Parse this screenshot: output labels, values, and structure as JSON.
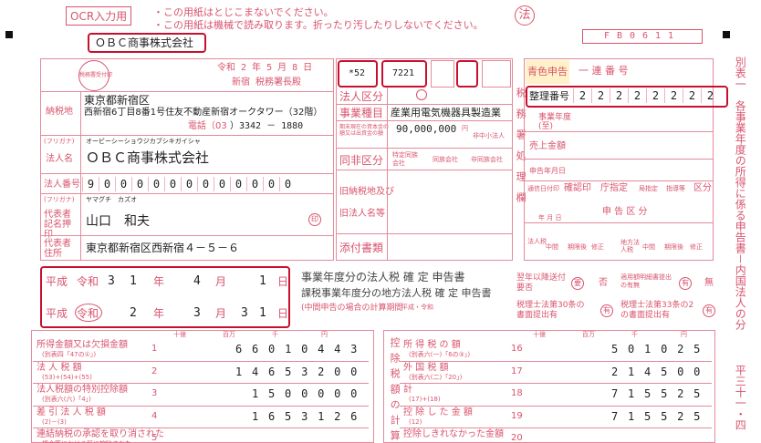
{
  "header": {
    "ocr_label": "OCR入力用",
    "notice1": "・この用紙はとじこまないでください。",
    "notice2": "・この用紙は機械で読み取ります。折ったり汚したりしないでください。",
    "hou_mark": "法",
    "form_code": "FB0611",
    "company_top": "ＯＢＣ商事株式会社"
  },
  "left": {
    "receipt_stamp": "税務署受付印",
    "date": "令和 2 年 5 月 8 日",
    "office": "新宿 税務署長殿",
    "address_label": "納税地",
    "address1": "東京都新宿区",
    "address2": "西新宿6丁目8番1号住友不動産新宿オークタワー（32階）",
    "phone_label": "電話（03",
    "phone_value": "）3342 － 1880",
    "furigana_label": "(フリガナ)",
    "furigana_company": "オービーシーショウジカブシキガイシャ",
    "corp_name_label": "法人名",
    "corp_name": "ＯＢＣ商事株式会社",
    "corp_number_label": "法人番号",
    "corp_number": [
      "9",
      "0",
      "0",
      "0",
      "0",
      "0",
      "0",
      "0",
      "0",
      "0",
      "0",
      "0",
      "0"
    ],
    "furigana_rep_label": "(フリガナ)",
    "furigana_rep": "ヤマグチ　カズオ",
    "rep_label": "代表者記名押印",
    "rep_name": "山口　和夫",
    "seal": "印",
    "rep_addr_label": "代表者住所",
    "rep_addr": "東京都新宿区西新宿４－５－６"
  },
  "middle": {
    "field1_label": "整理番号",
    "field1_value": "*52",
    "field2_value": "7221",
    "corp_class_label": "法人区分",
    "business_label": "事業種目",
    "business_value": "産業用電気機器具製造業",
    "capital_note": "期末現在の資本金の額又は出資金の額",
    "capital_value": "90,000,000",
    "capital_unit": "円",
    "sme_label": "非中小法人",
    "same_label": "同非区分",
    "same_opt1": "特定同族会社",
    "same_opt2": "同族会社",
    "same_opt3": "非同族会社",
    "old_addr_label": "旧納税地及び",
    "old_rep_label": "旧法人名等",
    "attach_label": "添付書類"
  },
  "right": {
    "blue_label": "青色申告",
    "serial_label": "一 連 番 号",
    "seiri_label": "整理番号",
    "seiri_digits": [
      "2",
      "2",
      "2",
      "2",
      "2",
      "2",
      "2",
      "2"
    ],
    "fiscal_year_label": "事業年度(至)",
    "sales_label": "売上金額",
    "date_label": "申告年月日",
    "notify_date": "通信日付印",
    "confirm": "確認印",
    "office_spec": "庁指定",
    "local_spec": "局指定",
    "guidance": "指導等",
    "category": "区分",
    "year_month_day": "年 月 日",
    "filing_class": "申 告 区 分",
    "corp_tax": "法人税",
    "local_corp_tax": "地方法人税",
    "interim": "中間",
    "after_expiry": "期限後",
    "amended": "修正",
    "kanzei": "確定"
  },
  "period": {
    "heisei": "平成",
    "reiwa": "令和",
    "from_year": "3",
    "from_year2": "1",
    "from_month": "4",
    "from_day": "1",
    "to_year": "2",
    "to_month": "3",
    "to_day1": "3",
    "to_day2": "1",
    "nen": "年",
    "gatsu": "月",
    "nichi": "日",
    "title1": "事業年度分の法人税 確 定 申告書",
    "title2": "課税事業年度分の地方法人税 確 定 申告書",
    "interim_note": "(中間申告の場合の計算期間",
    "heisei_reiwa": "平成・令和",
    "after_year": "翌年以降送付要否",
    "need": "要",
    "no_need": "否",
    "tax_acc_label": "適用額明細書提出の有無",
    "has": "有",
    "none": "無",
    "tax_att1": "税理士法第30条の書面提出有",
    "tax_att2": "税理士法第33条の2の書面提出有"
  },
  "table_left": {
    "units": [
      "十億",
      "百万",
      "千",
      "円"
    ],
    "rows": [
      {
        "label": "所得金額又は欠損金額",
        "sub": "(別表四「47の①」)",
        "no": "1",
        "value": "66010443"
      },
      {
        "label": "法 人 税 額",
        "sub": "(53)+(54)+(55)",
        "no": "2",
        "value": "14653200"
      },
      {
        "label": "法人税額の特別控除額",
        "sub": "(別表六(六)「4」)",
        "no": "3",
        "value": "1500000"
      },
      {
        "label": "差 引 法 人 税 額",
        "sub": "(2)－(3)",
        "no": "4",
        "value": "1653126"
      },
      {
        "label": "連結納税の承認を取り消された",
        "sub": "場合等における既に控除された",
        "no": "5",
        "value": ""
      }
    ]
  },
  "table_right": {
    "units": [
      "十億",
      "百万",
      "千",
      "円"
    ],
    "section_label": "控除税額の計算",
    "rows": [
      {
        "label": "所 得 税 の 額",
        "sub": "(別表六(一)「6の③」)",
        "no": "16",
        "value": "501025"
      },
      {
        "label": "外 国 税 額",
        "sub": "(別表六(二)「20」)",
        "no": "17",
        "value": "214500"
      },
      {
        "label": "計",
        "sub": "(17)+(18)",
        "no": "18",
        "value": "715525"
      },
      {
        "label": "控 除 し た 金 額",
        "sub": "(12)",
        "no": "19",
        "value": "715525"
      },
      {
        "label": "控除しきれなかった金額",
        "sub": "",
        "no": "20",
        "value": ""
      }
    ]
  },
  "side": {
    "vertical_text": "別表一　各事業年度の所得に係る申告書－内国法人の分",
    "vertical_text2": "平三十一・四",
    "vert_mid": "税務署処理欄"
  }
}
